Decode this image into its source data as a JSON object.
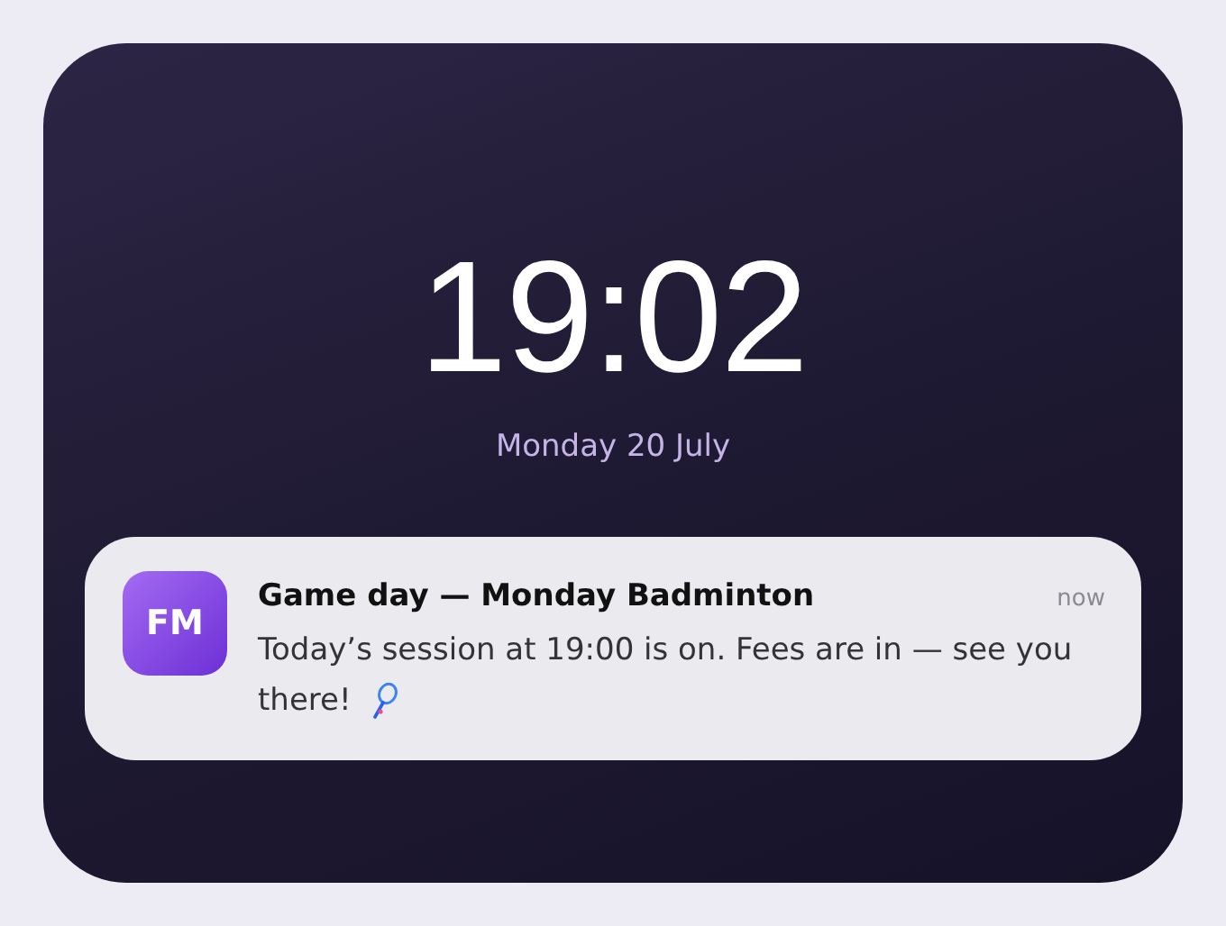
{
  "lock_screen": {
    "time": "19:02",
    "date": "Monday 20 July"
  },
  "notification": {
    "app_icon": "FM",
    "title": "Game day — Monday Badminton",
    "time": "now",
    "body": "Today’s session at 19:00 is on. Fees are in — see you there!"
  }
}
